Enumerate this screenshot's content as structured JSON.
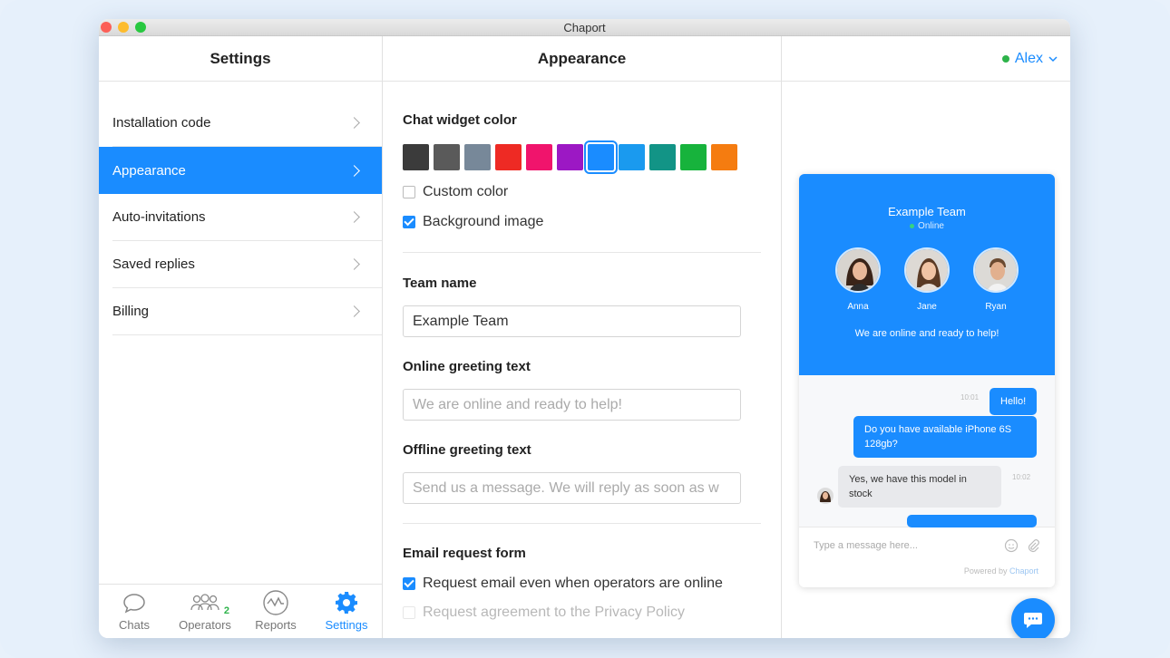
{
  "window": {
    "title": "Chaport"
  },
  "settings_panel": {
    "title": "Settings",
    "items": [
      {
        "label": "Installation code"
      },
      {
        "label": "Appearance"
      },
      {
        "label": "Auto-invitations"
      },
      {
        "label": "Saved replies"
      },
      {
        "label": "Billing"
      }
    ],
    "active_index": 1
  },
  "bottom_nav": {
    "items": [
      {
        "label": "Chats",
        "icon": "chat-bubble-icon"
      },
      {
        "label": "Operators",
        "icon": "operators-icon",
        "badge": "2"
      },
      {
        "label": "Reports",
        "icon": "reports-icon"
      },
      {
        "label": "Settings",
        "icon": "gear-icon"
      }
    ],
    "active": "Settings"
  },
  "appearance": {
    "title": "Appearance",
    "chat_widget_color_label": "Chat widget color",
    "colors": [
      "#3b3b3b",
      "#5a5a5a",
      "#778899",
      "#ee2a24",
      "#f0146c",
      "#9c18c4",
      "#1a8cff",
      "#1a9aef",
      "#129486",
      "#17b33c",
      "#f57c10"
    ],
    "selected_color_index": 6,
    "custom_color_label": "Custom color",
    "custom_color_checked": false,
    "background_image_label": "Background image",
    "background_image_checked": true,
    "team_name_label": "Team name",
    "team_name_value": "Example Team",
    "online_greeting_label": "Online greeting text",
    "online_greeting_placeholder": "We are online and ready to help!",
    "offline_greeting_label": "Offline greeting text",
    "offline_greeting_placeholder": "Send us a message. We will reply as soon as w",
    "email_form_label": "Email request form",
    "email_online_label": "Request email even when operators are online",
    "email_online_checked": true,
    "privacy_label": "Request agreement to the Privacy Policy"
  },
  "user_menu": {
    "name": "Alex",
    "status_color": "#2db34a"
  },
  "widget_preview": {
    "team_name": "Example Team",
    "status": "Online",
    "operators": [
      {
        "name": "Anna"
      },
      {
        "name": "Jane"
      },
      {
        "name": "Ryan"
      }
    ],
    "greeting": "We are online and ready to help!",
    "messages": [
      {
        "from": "visitor",
        "text": "Hello!",
        "time": "10:01"
      },
      {
        "from": "visitor",
        "text": "Do you have available iPhone 6S 128gb?"
      },
      {
        "from": "operator",
        "text": "Yes, we have this model in stock",
        "time": "10:02"
      }
    ],
    "composer_placeholder": "Type a message here...",
    "powered_prefix": "Powered by",
    "powered_brand": "Chaport"
  },
  "colors": {
    "accent": "#1a8cff",
    "online": "#2db34a"
  }
}
